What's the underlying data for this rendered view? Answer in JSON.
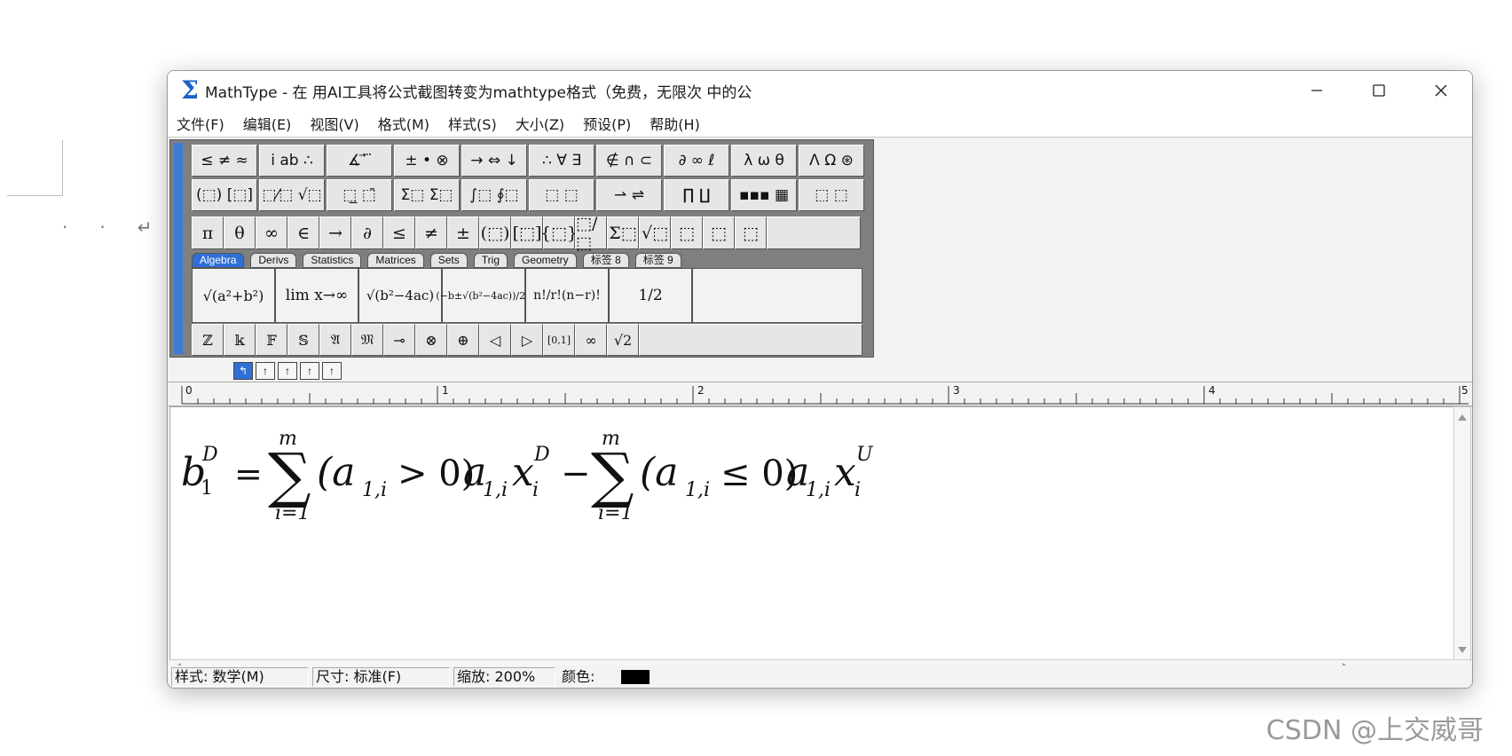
{
  "background": {
    "watermark": "CSDN @上交威哥"
  },
  "window": {
    "title": "MathType - 在 用AI工具将公式截图转变为mathtype格式（免费，无限次 中的公"
  },
  "menu": [
    "文件(F)",
    "编辑(E)",
    "视图(V)",
    "格式(M)",
    "样式(S)",
    "大小(Z)",
    "预设(P)",
    "帮助(H)"
  ],
  "palette_rows": [
    [
      "≤ ≠ ≈",
      "ⅰ ab ∴",
      "∡ ⃗ ⃛",
      "± • ⊗",
      "→ ⇔ ↓",
      "∴ ∀ ∃",
      "∉ ∩ ⊂",
      "∂ ∞ ℓ",
      "λ ω θ",
      "Λ Ω ⊛"
    ],
    [
      "(⬚) [⬚]",
      "⬚⁄⬚ √⬚",
      "⬚̲ ⬚̄",
      "Σ⬚ Σ⬚",
      "∫⬚ ∮⬚",
      "⬚ ⬚",
      "⇀ ⇌",
      "∏ ∐",
      "▪▪▪ ▦",
      "⬚ ⬚"
    ]
  ],
  "symbol_bar": [
    "π",
    "θ",
    "∞",
    "∈",
    "→",
    "∂",
    "≤",
    "≠",
    "±",
    "(⬚)",
    "[⬚]",
    "{⬚}",
    "⬚/⬚",
    "Σ⬚",
    "√⬚",
    "⬚",
    "⬚",
    "⬚"
  ],
  "tabs": [
    "Algebra",
    "Derivs",
    "Statistics",
    "Matrices",
    "Sets",
    "Trig",
    "Geometry",
    "标签 8",
    "标签 9"
  ],
  "active_tab": "Algebra",
  "templates": [
    "√(a²+b²)",
    "lim x→∞",
    "√(b²−4ac)",
    "(−b±√(b²−4ac))/2a",
    "n!/r!(n−r)!",
    "1/2"
  ],
  "small_symbols": [
    "ℤ",
    "𝕜",
    "𝔽",
    "𝕊",
    "𝔄",
    "𝔐",
    "⊸",
    "⊗",
    "⊕",
    "◁",
    "▷",
    "[0,1]",
    "∞",
    "√2"
  ],
  "nudge_buttons": [
    "↰",
    "↑",
    "↑",
    "↑",
    "↑"
  ],
  "ruler_labels": [
    "0",
    "1",
    "2",
    "3",
    "4",
    "5"
  ],
  "equation": {
    "lhs_base": "b",
    "lhs_sup": "D",
    "lhs_sub": "1",
    "eq": "=",
    "sum_upper": "m",
    "sum_lower": "i=1",
    "term1": "(a",
    "term1_sub": "1,i",
    "term1_rel": "> 0)",
    "coef": "a",
    "coef_sub": "1,i",
    "x": "x",
    "x1_sup": "D",
    "x_sub": "i",
    "minus": "−",
    "term2_rel": "≤ 0)",
    "x2_sup": "U"
  },
  "status": {
    "style": "样式: 数学(M)",
    "size": "尺寸: 标准(F)",
    "zoom": "缩放: 200%",
    "color_label": "颜色:",
    "color_value": "#000000"
  }
}
